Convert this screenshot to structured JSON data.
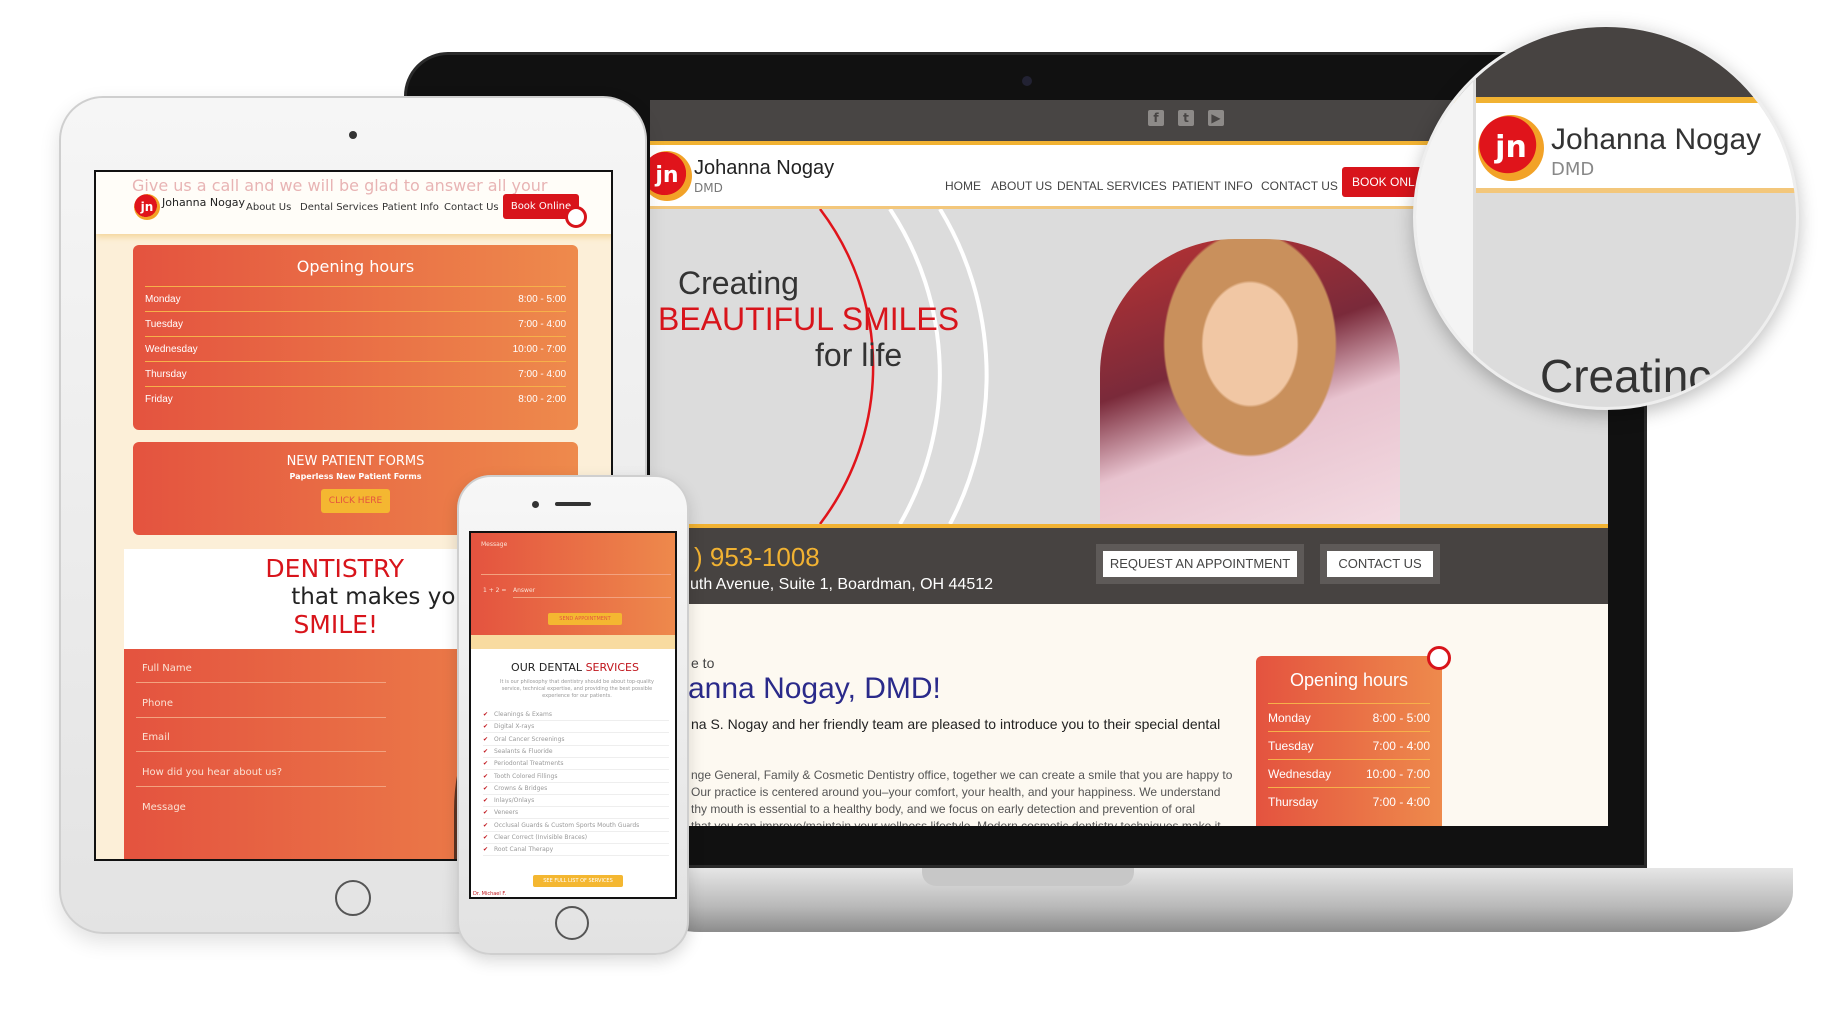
{
  "colors": {
    "accent_red": "#d8141b",
    "orange_start": "#e4533f",
    "orange_end": "#ee8a4c",
    "gold": "#f1b232",
    "dark_band": "#474341",
    "navy": "#2a2a8a"
  },
  "brand": {
    "name": "Johanna Nogay",
    "suffix": "DMD",
    "logo_letter": "jn"
  },
  "laptop": {
    "social_icons": [
      "facebook-icon",
      "twitter-icon",
      "youtube-icon"
    ],
    "nav": [
      "HOME",
      "ABOUT US",
      "DENTAL SERVICES",
      "PATIENT INFO",
      "CONTACT US"
    ],
    "book_label": "BOOK ONL",
    "hero": {
      "line1": "Creating",
      "line2": "BEAUTIFUL SMILES",
      "line3": "for life"
    },
    "phone": ") 953-1008",
    "address": "uth Avenue, Suite 1, Boardman, OH 44512",
    "request_btn": "REQUEST AN APPOINTMENT",
    "contact_btn": "CONTACT US",
    "welcome_pre": "e to",
    "welcome_title": "anna Nogay, DMD!",
    "intro": "na S. Nogay and her friendly team are pleased to introduce you to their special dental",
    "body": [
      "nge General, Family & Cosmetic Dentistry office, together we can create a smile that you are happy to",
      "Our practice is centered around you–your comfort, your health, and your happiness. We understand",
      "thy mouth is essential to a healthy body, and we focus on early detection and prevention of oral",
      "that you can improve/maintain your wellness lifestyle. Modern cosmetic dentistry techniques make it"
    ],
    "hours_title": "Opening hours",
    "hours": [
      {
        "day": "Monday",
        "time": "8:00 - 5:00"
      },
      {
        "day": "Tuesday",
        "time": "7:00 - 4:00"
      },
      {
        "day": "Wednesday",
        "time": "10:00 - 7:00"
      },
      {
        "day": "Thursday",
        "time": "7:00 - 4:00"
      }
    ]
  },
  "tablet": {
    "faded_text": "Give us a call and we will be glad to answer all your",
    "nav": [
      "About Us",
      "Dental Services",
      "Patient Info",
      "Contact Us"
    ],
    "book_label": "Book Online",
    "hours_title": "Opening hours",
    "hours": [
      {
        "day": "Monday",
        "time": "8:00 - 5:00"
      },
      {
        "day": "Tuesday",
        "time": "7:00 - 4:00"
      },
      {
        "day": "Wednesday",
        "time": "10:00 - 7:00"
      },
      {
        "day": "Thursday",
        "time": "7:00 - 4:00"
      },
      {
        "day": "Friday",
        "time": "8:00 - 2:00"
      }
    ],
    "forms_title": "NEW PATIENT FORMS",
    "forms_sub": "Paperless New Patient Forms",
    "forms_btn": "CLICK HERE",
    "tag1": "DENTISTRY",
    "tag2": "that makes you",
    "tag3": "SMILE!",
    "fields": [
      "Full Name",
      "Phone",
      "Email",
      "How did you hear about us?",
      "Message"
    ]
  },
  "phone": {
    "message_placeholder": "Message",
    "captcha": "1 + 2 =",
    "answer_placeholder": "Answer",
    "send_btn": "SEND APPOINTMENT",
    "services_title_a": "OUR DENTAL",
    "services_title_b": "SERVICES",
    "services_intro": "It is our philosophy that dentistry should be about top-quality service, technical expertise, and providing the best possible experience for our patients.",
    "services": [
      "Cleanings & Exams",
      "Digital X-rays",
      "Oral Cancer Screenings",
      "Sealants & Fluoride",
      "Periodontal Treatments",
      "Tooth Colored Fillings",
      "Crowns & Bridges",
      "Inlays/Onlays",
      "Veneers",
      "Occlusal Guards & Custom Sports Mouth Guards",
      "Clear Correct (Invisible Braces)",
      "Root Canal Therapy"
    ],
    "full_list_btn": "SEE FULL LIST OF SERVICES",
    "footer_fragment": "Dr. Michael F."
  },
  "magnifier": {
    "hero_fragment": "Creatinc"
  }
}
